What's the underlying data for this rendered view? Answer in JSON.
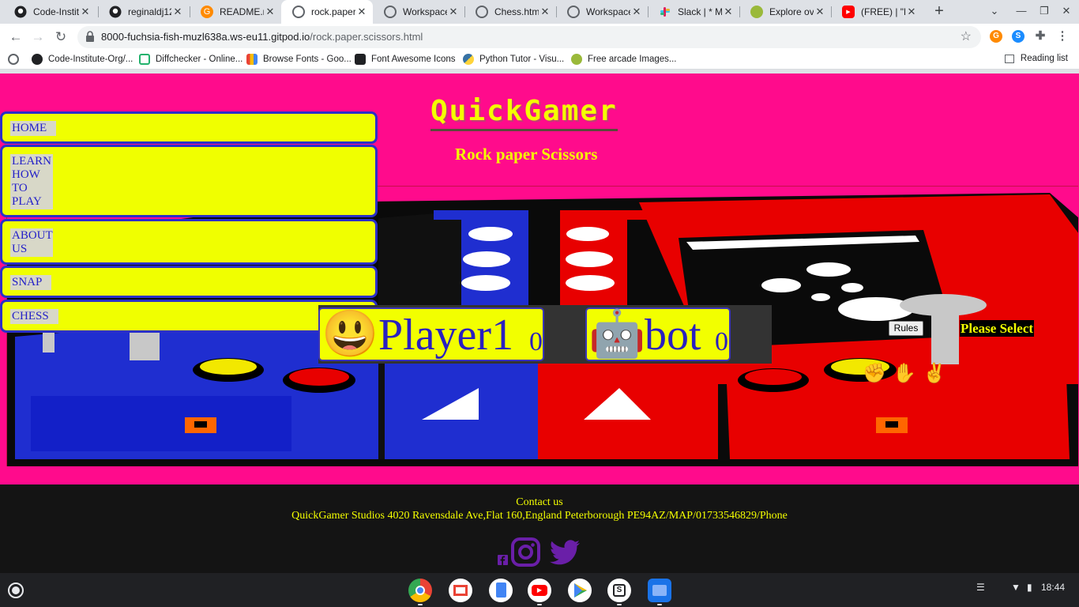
{
  "browser": {
    "tabs": [
      {
        "title": "Code-Institu",
        "icon": "github-icon"
      },
      {
        "title": "reginaldj12",
        "icon": "github-icon"
      },
      {
        "title": "README.m",
        "icon": "gitpod-icon"
      },
      {
        "title": "rock.paper.s",
        "icon": "globe-icon",
        "active": true
      },
      {
        "title": "Workspace",
        "icon": "globe-icon"
      },
      {
        "title": "Chess.html",
        "icon": "globe-icon"
      },
      {
        "title": "Workspace",
        "icon": "globe-icon"
      },
      {
        "title": "Slack | * Ma",
        "icon": "slack-icon"
      },
      {
        "title": "Explore ove",
        "icon": "opengameart-icon"
      },
      {
        "title": "(FREE) | \"Fle",
        "icon": "youtube-icon"
      }
    ],
    "url_host": "8000-fuchsia-fish-muzl638a.ws-eu11.gitpod.io",
    "url_path": "/rock.paper.scissors.html",
    "bookmarks": [
      {
        "label": "Code-Institute-Org/...",
        "icon": "github-icon"
      },
      {
        "label": "Diffchecker - Online...",
        "icon": "diffchecker-icon"
      },
      {
        "label": "Browse Fonts - Goo...",
        "icon": "google-fonts-icon"
      },
      {
        "label": "Font Awesome Icons",
        "icon": "flag-icon"
      },
      {
        "label": "Python Tutor - Visu...",
        "icon": "python-icon"
      },
      {
        "label": "Free arcade Images...",
        "icon": "opengameart-icon"
      }
    ],
    "reading_list": "Reading list"
  },
  "page": {
    "logo": "QuickGamer",
    "subtitle": "Rock paper Scissors",
    "nav": [
      "HOME",
      "LEARN HOW TO PLAY",
      "ABOUT US",
      "SNAP",
      "CHESS"
    ],
    "player": {
      "emoji": "😃",
      "name": "Player1",
      "score": "0"
    },
    "bot": {
      "emoji": "🤖",
      "name": "bot",
      "score": "0"
    },
    "rules_label": "Rules",
    "prompt": "Please Select",
    "choices": [
      "✊",
      "✋",
      "✌"
    ],
    "footer": {
      "contact": "Contact us",
      "address": "QuickGamer Studios 4020 Ravensdale Ave,Flat 160,England Peterborough PE94AZ/MAP/01733546829/Phone"
    }
  },
  "shelf": {
    "time": "18:44",
    "apps": [
      "chrome-icon",
      "gmail-icon",
      "docs-icon",
      "youtube-icon",
      "play-store-icon",
      "slides-icon",
      "files-icon"
    ]
  },
  "colors": {
    "page_bg": "#ff0b8c",
    "accent_yellow": "#f4ff00",
    "nav_text": "#2320c8",
    "footer_bg": "#141414"
  }
}
